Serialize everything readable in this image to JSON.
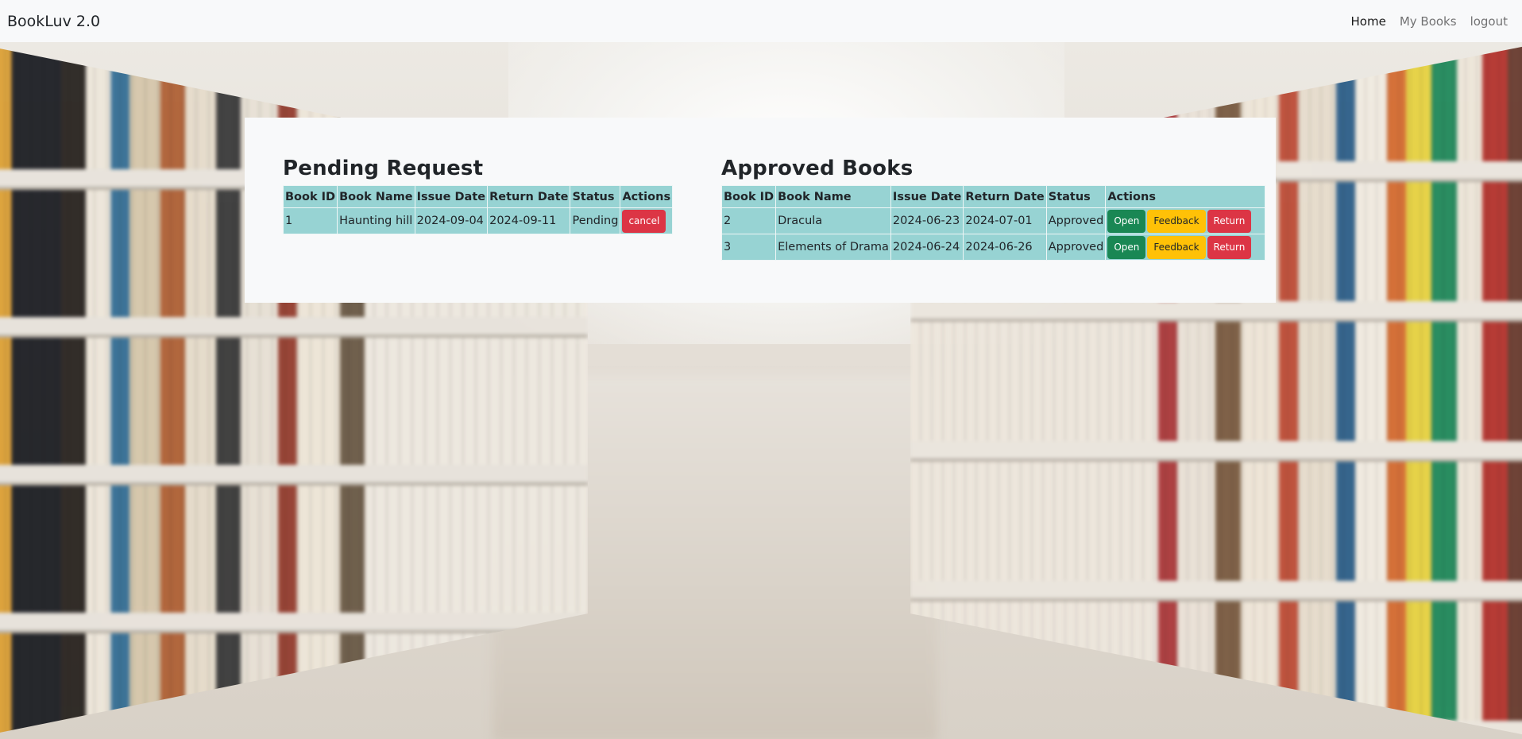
{
  "navbar": {
    "brand": "BookLuv 2.0",
    "links": [
      {
        "label": "Home",
        "active": true
      },
      {
        "label": "My Books",
        "active": false
      },
      {
        "label": "logout",
        "active": false
      }
    ]
  },
  "pending": {
    "title": "Pending Request",
    "headers": [
      "Book ID",
      "Book Name",
      "Issue Date",
      "Return Date",
      "Status",
      "Actions"
    ],
    "rows": [
      {
        "id": "1",
        "name": "Haunting hill",
        "issue": "2024-09-04",
        "return": "2024-09-11",
        "status": "Pending",
        "cancel": "cancel"
      }
    ]
  },
  "approved": {
    "title": "Approved Books",
    "headers": [
      "Book ID",
      "Book Name",
      "Issue Date",
      "Return Date",
      "Status",
      "Actions"
    ],
    "rows": [
      {
        "id": "2",
        "name": "Dracula",
        "issue": "2024-06-23",
        "return": "2024-07-01",
        "status": "Approved",
        "open": "Open",
        "feedback": "Feedback",
        "return_btn": "Return"
      },
      {
        "id": "3",
        "name": "Elements of Drama",
        "issue": "2024-06-24",
        "return": "2024-06-26",
        "status": "Approved",
        "open": "Open",
        "feedback": "Feedback",
        "return_btn": "Return"
      }
    ]
  },
  "colors": {
    "navbar_bg": "#f8f9fa",
    "table_cell_bg": "#97d3d3",
    "danger": "#dc3545",
    "success": "#198754",
    "warning": "#ffc107"
  }
}
